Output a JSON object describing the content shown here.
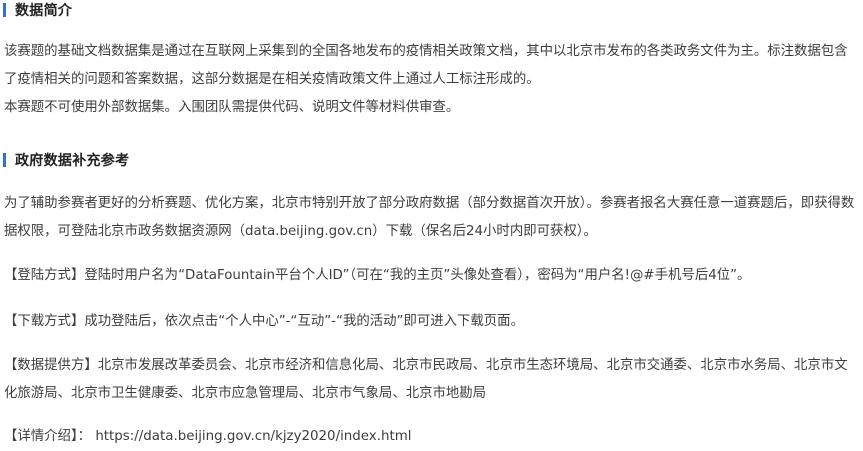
{
  "section1": {
    "title": "数据简介",
    "paragraph1": "该赛题的基础文档数据集是通过在互联网上采集到的全国各地发布的疫情相关政策文档，其中以北京市发布的各类政务文件为主。标注数据包含了疫情相关的问题和答案数据，这部分数据是在相关疫情政策文件上通过人工标注形成的。",
    "paragraph2": "本赛题不可使用外部数据集。入围团队需提供代码、说明文件等材料供审查。"
  },
  "section2": {
    "title": "政府数据补充参考",
    "intro": "为了辅助参赛者更好的分析赛题、优化方案，北京市特别开放了部分政府数据（部分数据首次开放）。参赛者报名大赛任意一道赛题后，即获得数据权限，可登陆北京市政务数据资源网（data.beijing.gov.cn）下载（保名后24小时内即可获权）。",
    "login": "【登陆方式】登陆时用户名为“DataFountain平台个人ID”（可在“我的主页”头像处查看），密码为“用户名!@#手机号后4位”。",
    "download": "【下载方式】成功登陆后，依次点击“个人中心”-“互动”-“我的活动”即可进入下载页面。",
    "providers": "【数据提供方】北京市发展改革委员会、北京市经济和信息化局、北京市民政局、北京市生态环境局、北京市交通委、北京市水务局、北京市文化旅游局、北京市卫生健康委、北京市应急管理局、北京市气象局、北京市地勘局",
    "details_label": "【详情介绍】：",
    "details_url": "https://data.beijing.gov.cn/kjzy2020/index.html"
  },
  "colors": {
    "accent_bar": "#2f6fd6",
    "heading_text": "#222222",
    "body_text": "#3e3e3e"
  }
}
